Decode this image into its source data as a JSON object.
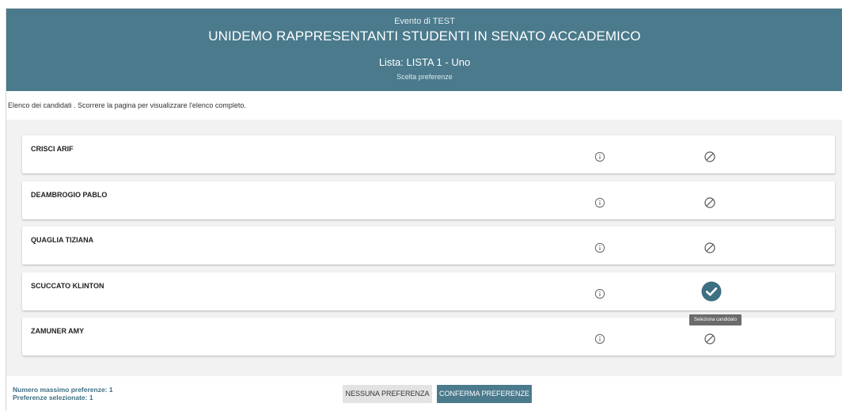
{
  "header": {
    "event": "Evento di TEST",
    "title": "UNIDEMO RAPPRESENTANTI STUDENTI IN SENATO ACCADEMICO",
    "lista": "Lista: LISTA 1 - Uno",
    "subtitle": "Scelta preferenze"
  },
  "instructions": "Elenco dei candidati . Scorrere la pagina per visualizzare l'elenco completo.",
  "candidates": [
    {
      "name": "CRISCI ARIF",
      "selected": false
    },
    {
      "name": "DEAMBROGIO PABLO",
      "selected": false
    },
    {
      "name": "QUAGLIA TIZIANA",
      "selected": false
    },
    {
      "name": "SCUCCATO KLINTON",
      "selected": true
    },
    {
      "name": "ZAMUNER AMY",
      "selected": false
    }
  ],
  "tooltip": "Seleziona candidato",
  "footer": {
    "max_label": "Numero massimo preferenze: 1",
    "selected_label": "Preferenze selezionate: 1"
  },
  "buttons": {
    "none_label": "NESSUNA PREFERENZA",
    "confirm_label": "CONFERMA PREFERENZE"
  },
  "colors": {
    "primary": "#4a7a8c",
    "check": "#3e6f82"
  },
  "icons": {
    "info": "info-icon",
    "unselected": "ban-icon",
    "selected": "check-circle-icon"
  }
}
